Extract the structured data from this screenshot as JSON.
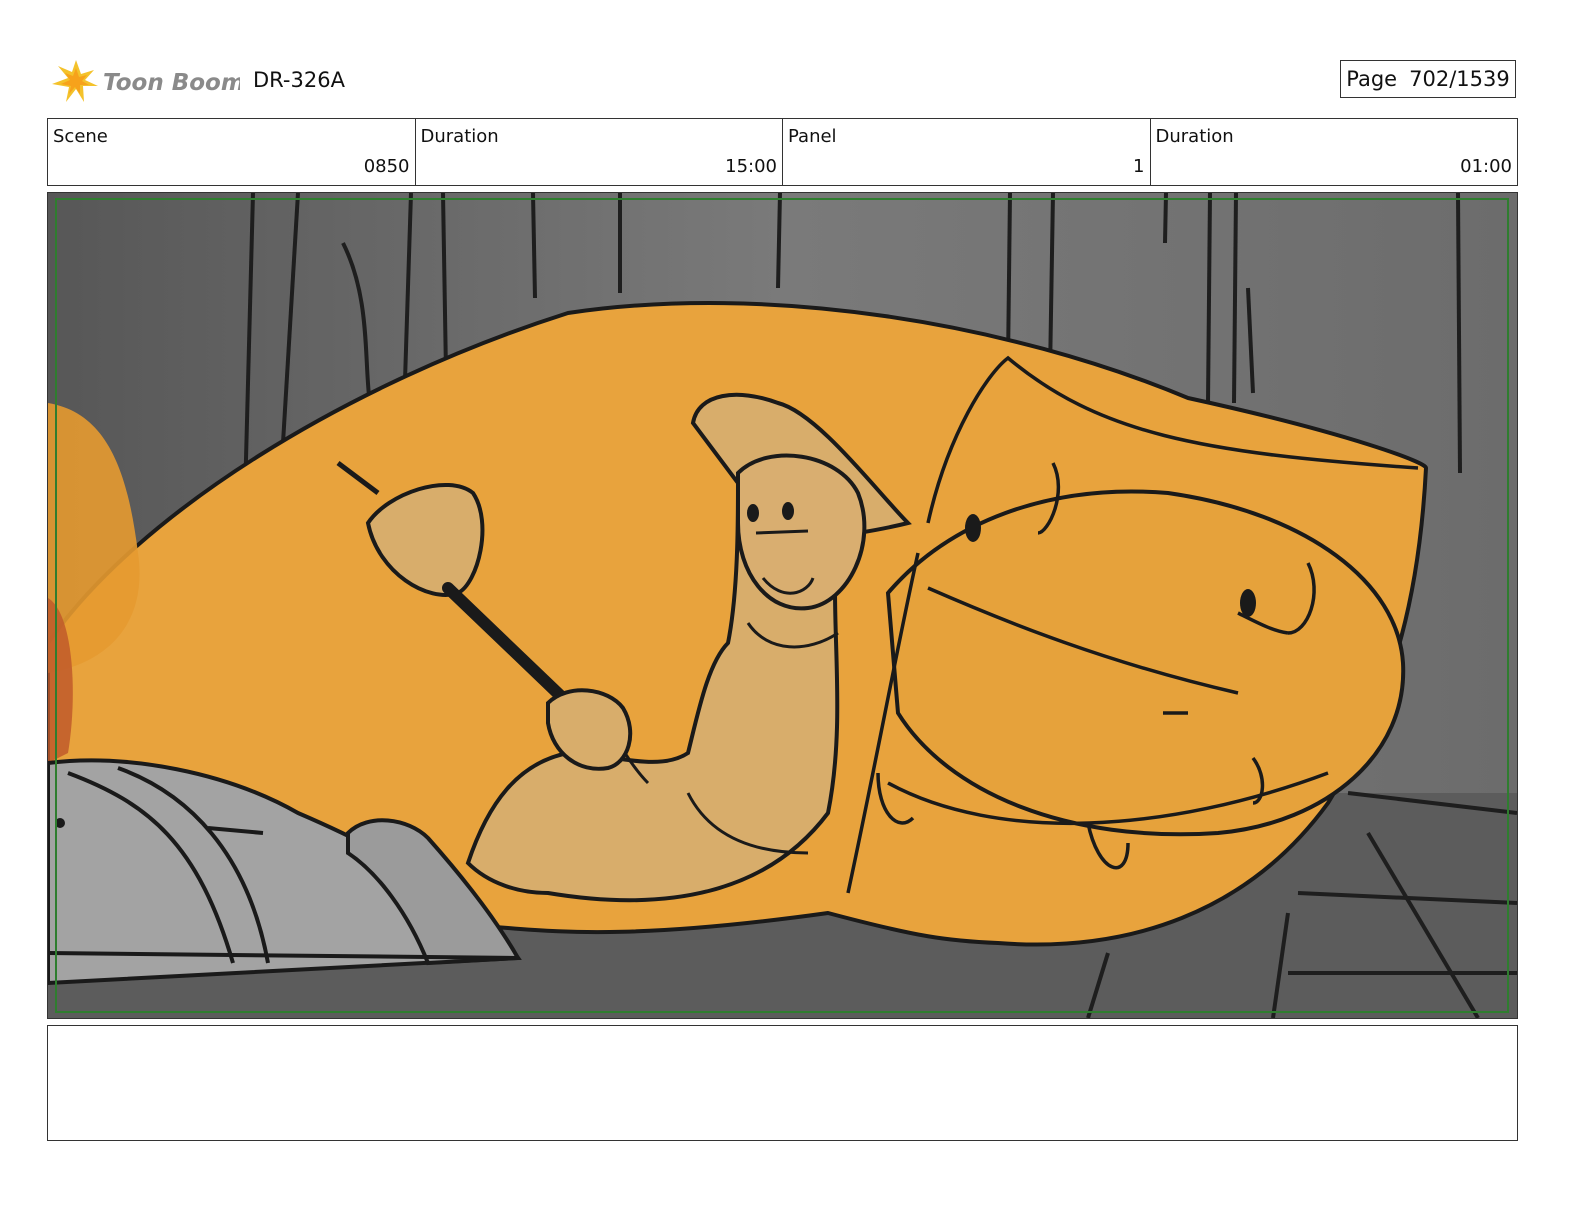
{
  "header": {
    "logo_text": "Toon Boom",
    "doc_id": "DR-326A",
    "page_label": "Page",
    "page_number": "702/1539"
  },
  "info_bar": {
    "scene_label": "Scene",
    "scene_value": "0850",
    "scene_duration_label": "Duration",
    "scene_duration_value": "15:00",
    "panel_label": "Panel",
    "panel_value": "1",
    "panel_duration_label": "Duration",
    "panel_duration_value": "01:00"
  },
  "panel_image": {
    "icon": "storyboard-sketch-image",
    "colors": {
      "background": "#6e6e6e",
      "creature": "#e8a33d",
      "character": "#d8ad6b",
      "vehicle": "#a3a3a3",
      "safe_frame": "#2f7d2f"
    }
  },
  "notes": {
    "text": ""
  }
}
